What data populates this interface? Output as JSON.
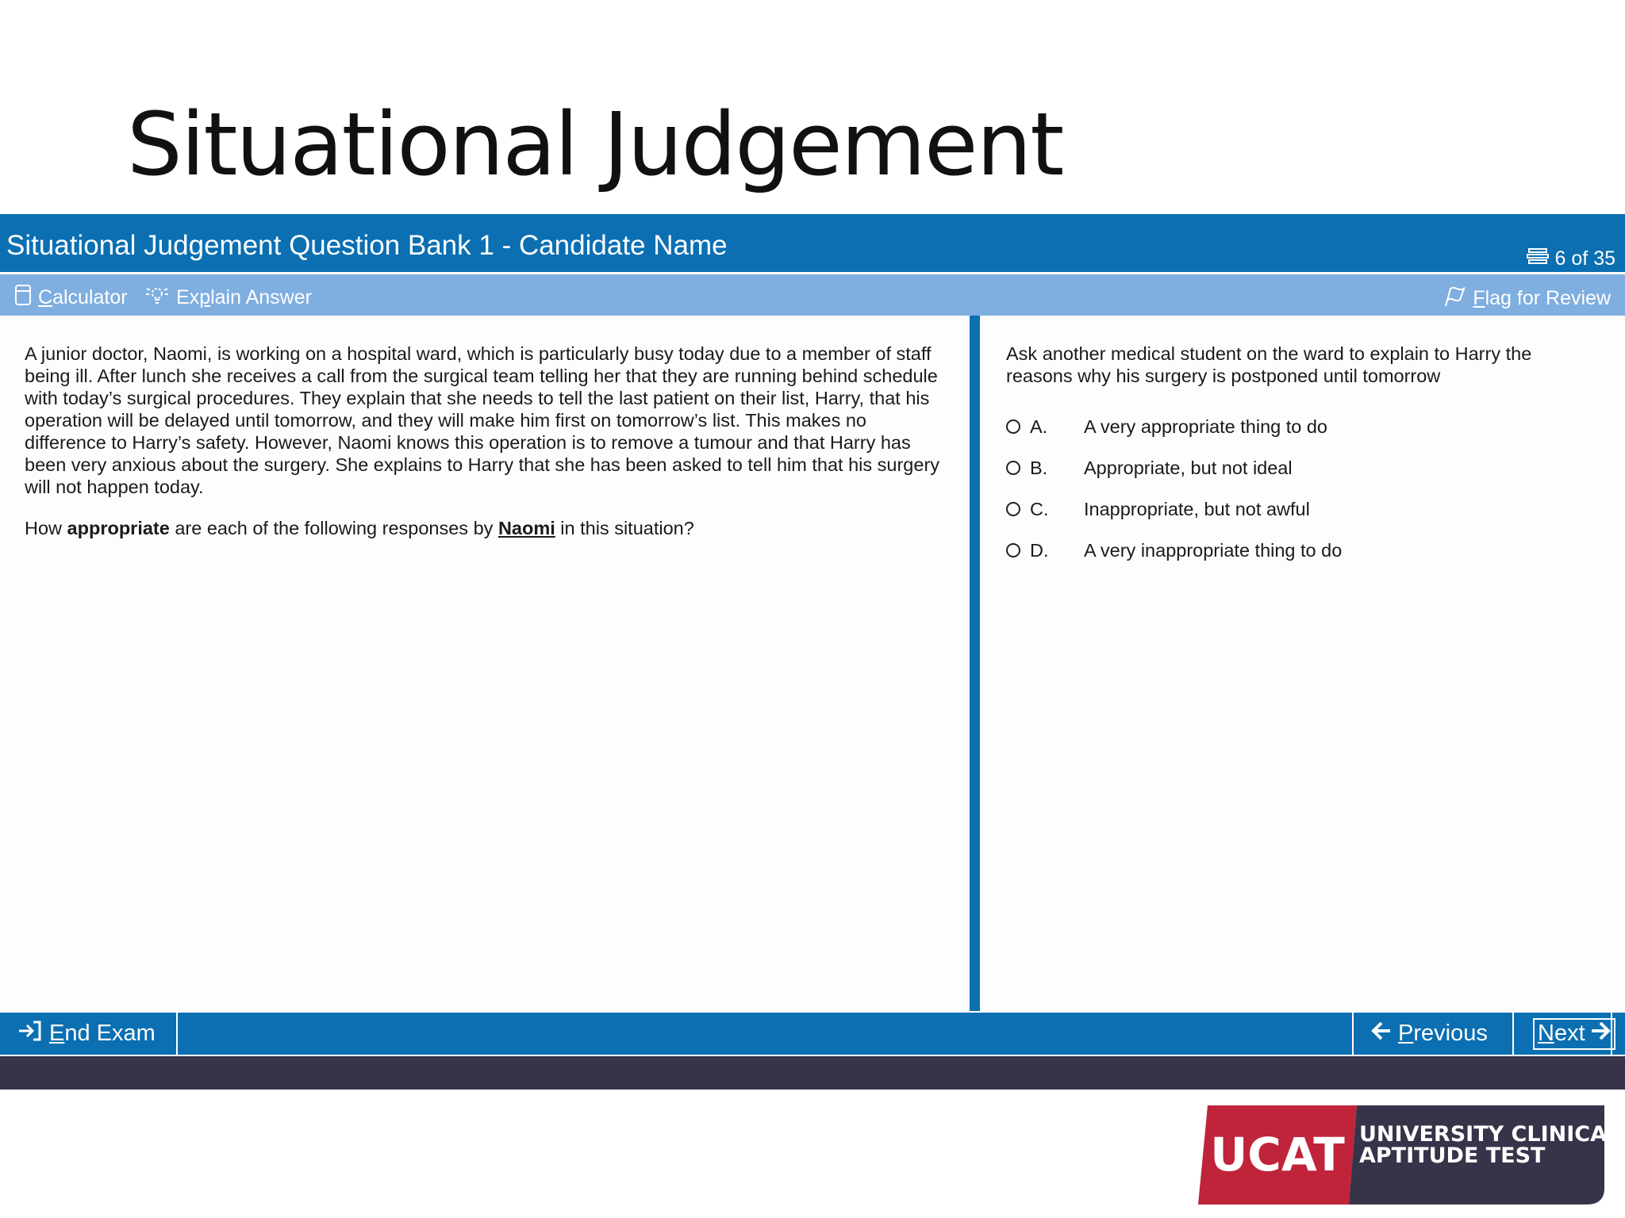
{
  "slide": {
    "title": "Situational Judgement"
  },
  "header": {
    "exam_title": "Situational Judgement Question Bank 1 - Candidate Name",
    "progress": "6 of 35"
  },
  "toolbar": {
    "calculator_first": "C",
    "calculator_rest": "alculator",
    "explain_pre": "Ex",
    "explain_u": "p",
    "explain_post": "lain Answer",
    "flag_first": "F",
    "flag_rest": "lag for Review"
  },
  "question": {
    "scenario": "A junior doctor, Naomi, is working on a hospital ward, which is particularly busy today due to a member of staff being ill. After lunch she receives a call from the surgical team telling her that they are running behind schedule with today’s surgical procedures. They explain that she needs to tell the last patient on their list, Harry, that his operation will be delayed until tomorrow, and they will make him first on tomorrow’s list. This makes no difference to Harry’s safety. However, Naomi knows this operation is to remove a tumour and that Harry has been very anxious about the surgery. She explains to Harry that she has been asked to tell him that his surgery will not happen today.",
    "prompt_pre": "How ",
    "prompt_bold": "appropriate",
    "prompt_mid": " are each of the following responses by ",
    "prompt_name": "Naomi",
    "prompt_post": " in this situation?"
  },
  "response": {
    "text": "Ask another medical student on the ward to explain to Harry the reasons why his surgery is postponed until tomorrow",
    "options": [
      {
        "letter": "A.",
        "label": "A very appropriate thing to do"
      },
      {
        "letter": "B.",
        "label": "Appropriate, but not ideal"
      },
      {
        "letter": "C.",
        "label": "Inappropriate, but not awful"
      },
      {
        "letter": "D.",
        "label": "A very inappropriate thing to do"
      }
    ]
  },
  "footer": {
    "end_first": "E",
    "end_rest": "nd Exam",
    "prev_first": "P",
    "prev_rest": "revious",
    "next_first": "N",
    "next_rest": "ext"
  },
  "logo": {
    "wordmark": "UCAT",
    "line1": "UNIVERSITY CLINICAL",
    "line2": "APTITUDE TEST"
  },
  "colors": {
    "primary_blue": "#0b6fb2",
    "toolbar_blue": "#7faee0",
    "status_strip": "#363449",
    "logo_red": "#c0243a",
    "logo_navy": "#363449"
  }
}
